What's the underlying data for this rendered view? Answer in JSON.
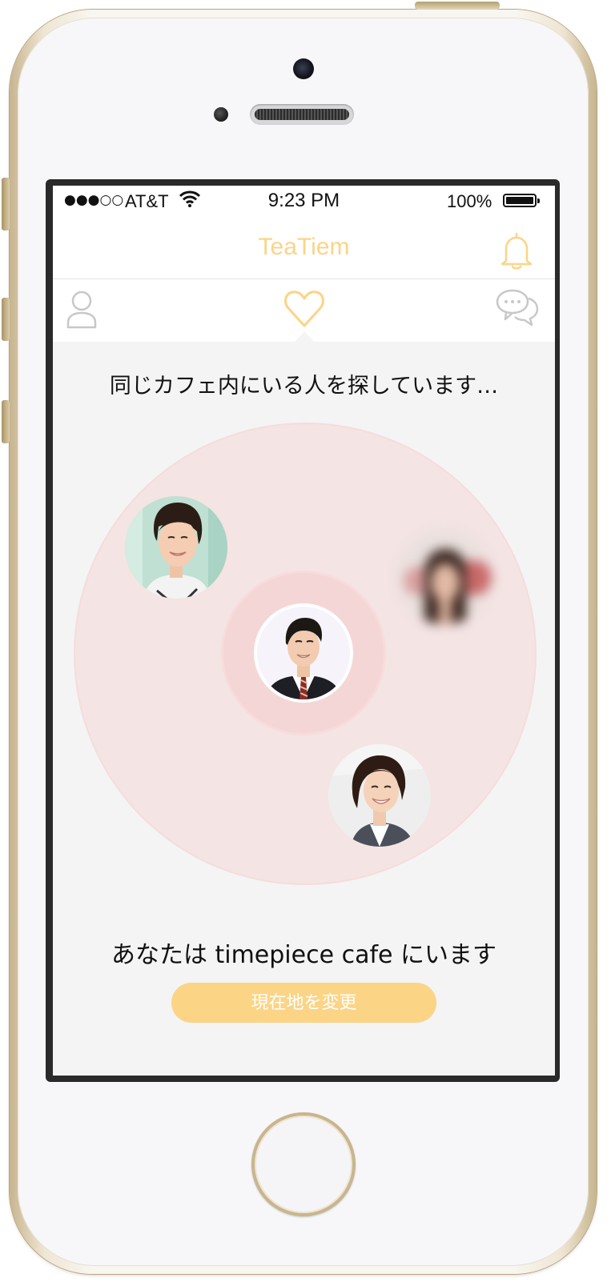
{
  "status_bar": {
    "signal": "●●●○○",
    "carrier": "AT&T",
    "time": "9:23 PM",
    "battery": "100%"
  },
  "nav": {
    "title": "TeaTiem",
    "title_color": "#fbd486"
  },
  "tabs": [
    {
      "icon": "person-icon",
      "active": false
    },
    {
      "icon": "heart-icon",
      "active": true
    },
    {
      "icon": "chat-bubbles-icon",
      "active": false
    }
  ],
  "main": {
    "search_status": "同じカフェ内にいる人を探しています…",
    "location_text": "あなたは timepiece cafe にいます",
    "change_location_button": "現在地を変更"
  },
  "colors": {
    "accent": "#fbd486",
    "radar_outer": "#f4e4e4",
    "radar_inner": "#f5d6d6",
    "inactive_icon": "#c8c8c8"
  }
}
